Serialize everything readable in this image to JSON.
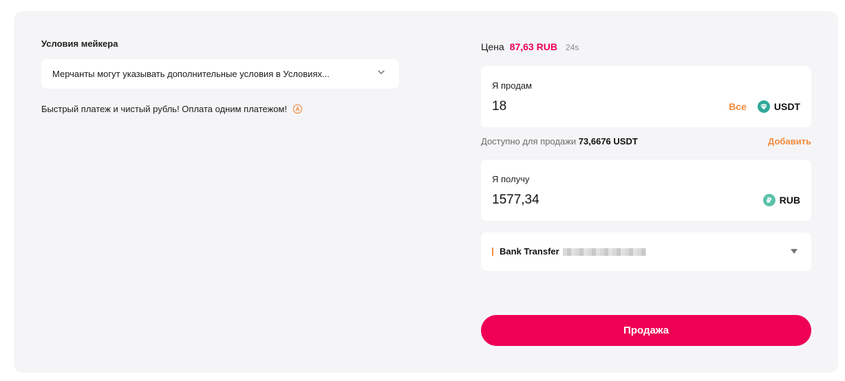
{
  "maker_terms": {
    "title": "Условия мейкера",
    "select_text": "Мерчанты могут указывать дополнительные условия в Условиях...",
    "promo_text": "Быстрый платеж и чистый рубль! Оплата одним платежом!"
  },
  "price": {
    "label": "Цена",
    "value": "87,63 RUB",
    "timer": "24s"
  },
  "sell": {
    "label": "Я продам",
    "amount": "18",
    "all_label": "Все",
    "asset": "USDT",
    "asset_icon": "usdt-diamond-icon"
  },
  "available": {
    "label": "Доступно для продажи",
    "value": "73,6676 USDT",
    "add_label": "Добавить"
  },
  "receive": {
    "label": "Я получу",
    "amount": "1577,34",
    "asset": "RUB",
    "asset_icon_glyph": "₽"
  },
  "payment": {
    "method": "Bank Transfer"
  },
  "actions": {
    "submit_label": "Продажа"
  },
  "colors": {
    "accent": "#ef0054",
    "secondary_accent": "#f08a3e",
    "usdt": "#2fa89a",
    "rub": "#5bc2a9",
    "panel_bg": "#f5f5f7"
  }
}
